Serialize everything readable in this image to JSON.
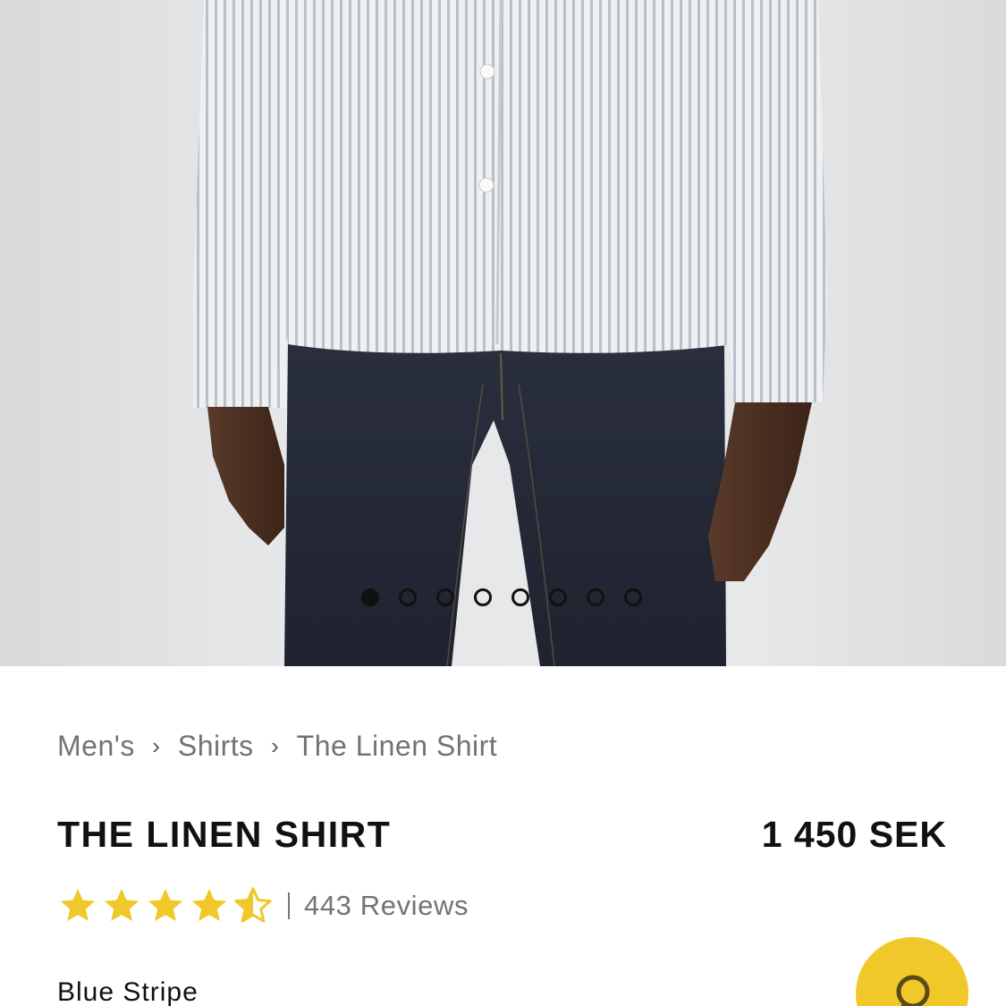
{
  "product_gallery": {
    "image_description": "Model wearing light blue striped linen shirt with dark denim jeans",
    "slide_count": 8,
    "active_slide": 1
  },
  "breadcrumb": {
    "items": [
      "Men's",
      "Shirts",
      "The Linen Shirt"
    ],
    "separator": "›"
  },
  "product": {
    "name": "THE LINEN SHIRT",
    "price": "1 450 SEK",
    "rating": 4.5,
    "rating_max": 5,
    "reviews_label": "443 Reviews",
    "color_name": "Blue Stripe"
  },
  "colors": {
    "star": "#f1c82a",
    "fab": "#f1c82a",
    "text_primary": "#111111",
    "text_muted": "#737373"
  },
  "fab": {
    "icon": "chat-icon"
  }
}
